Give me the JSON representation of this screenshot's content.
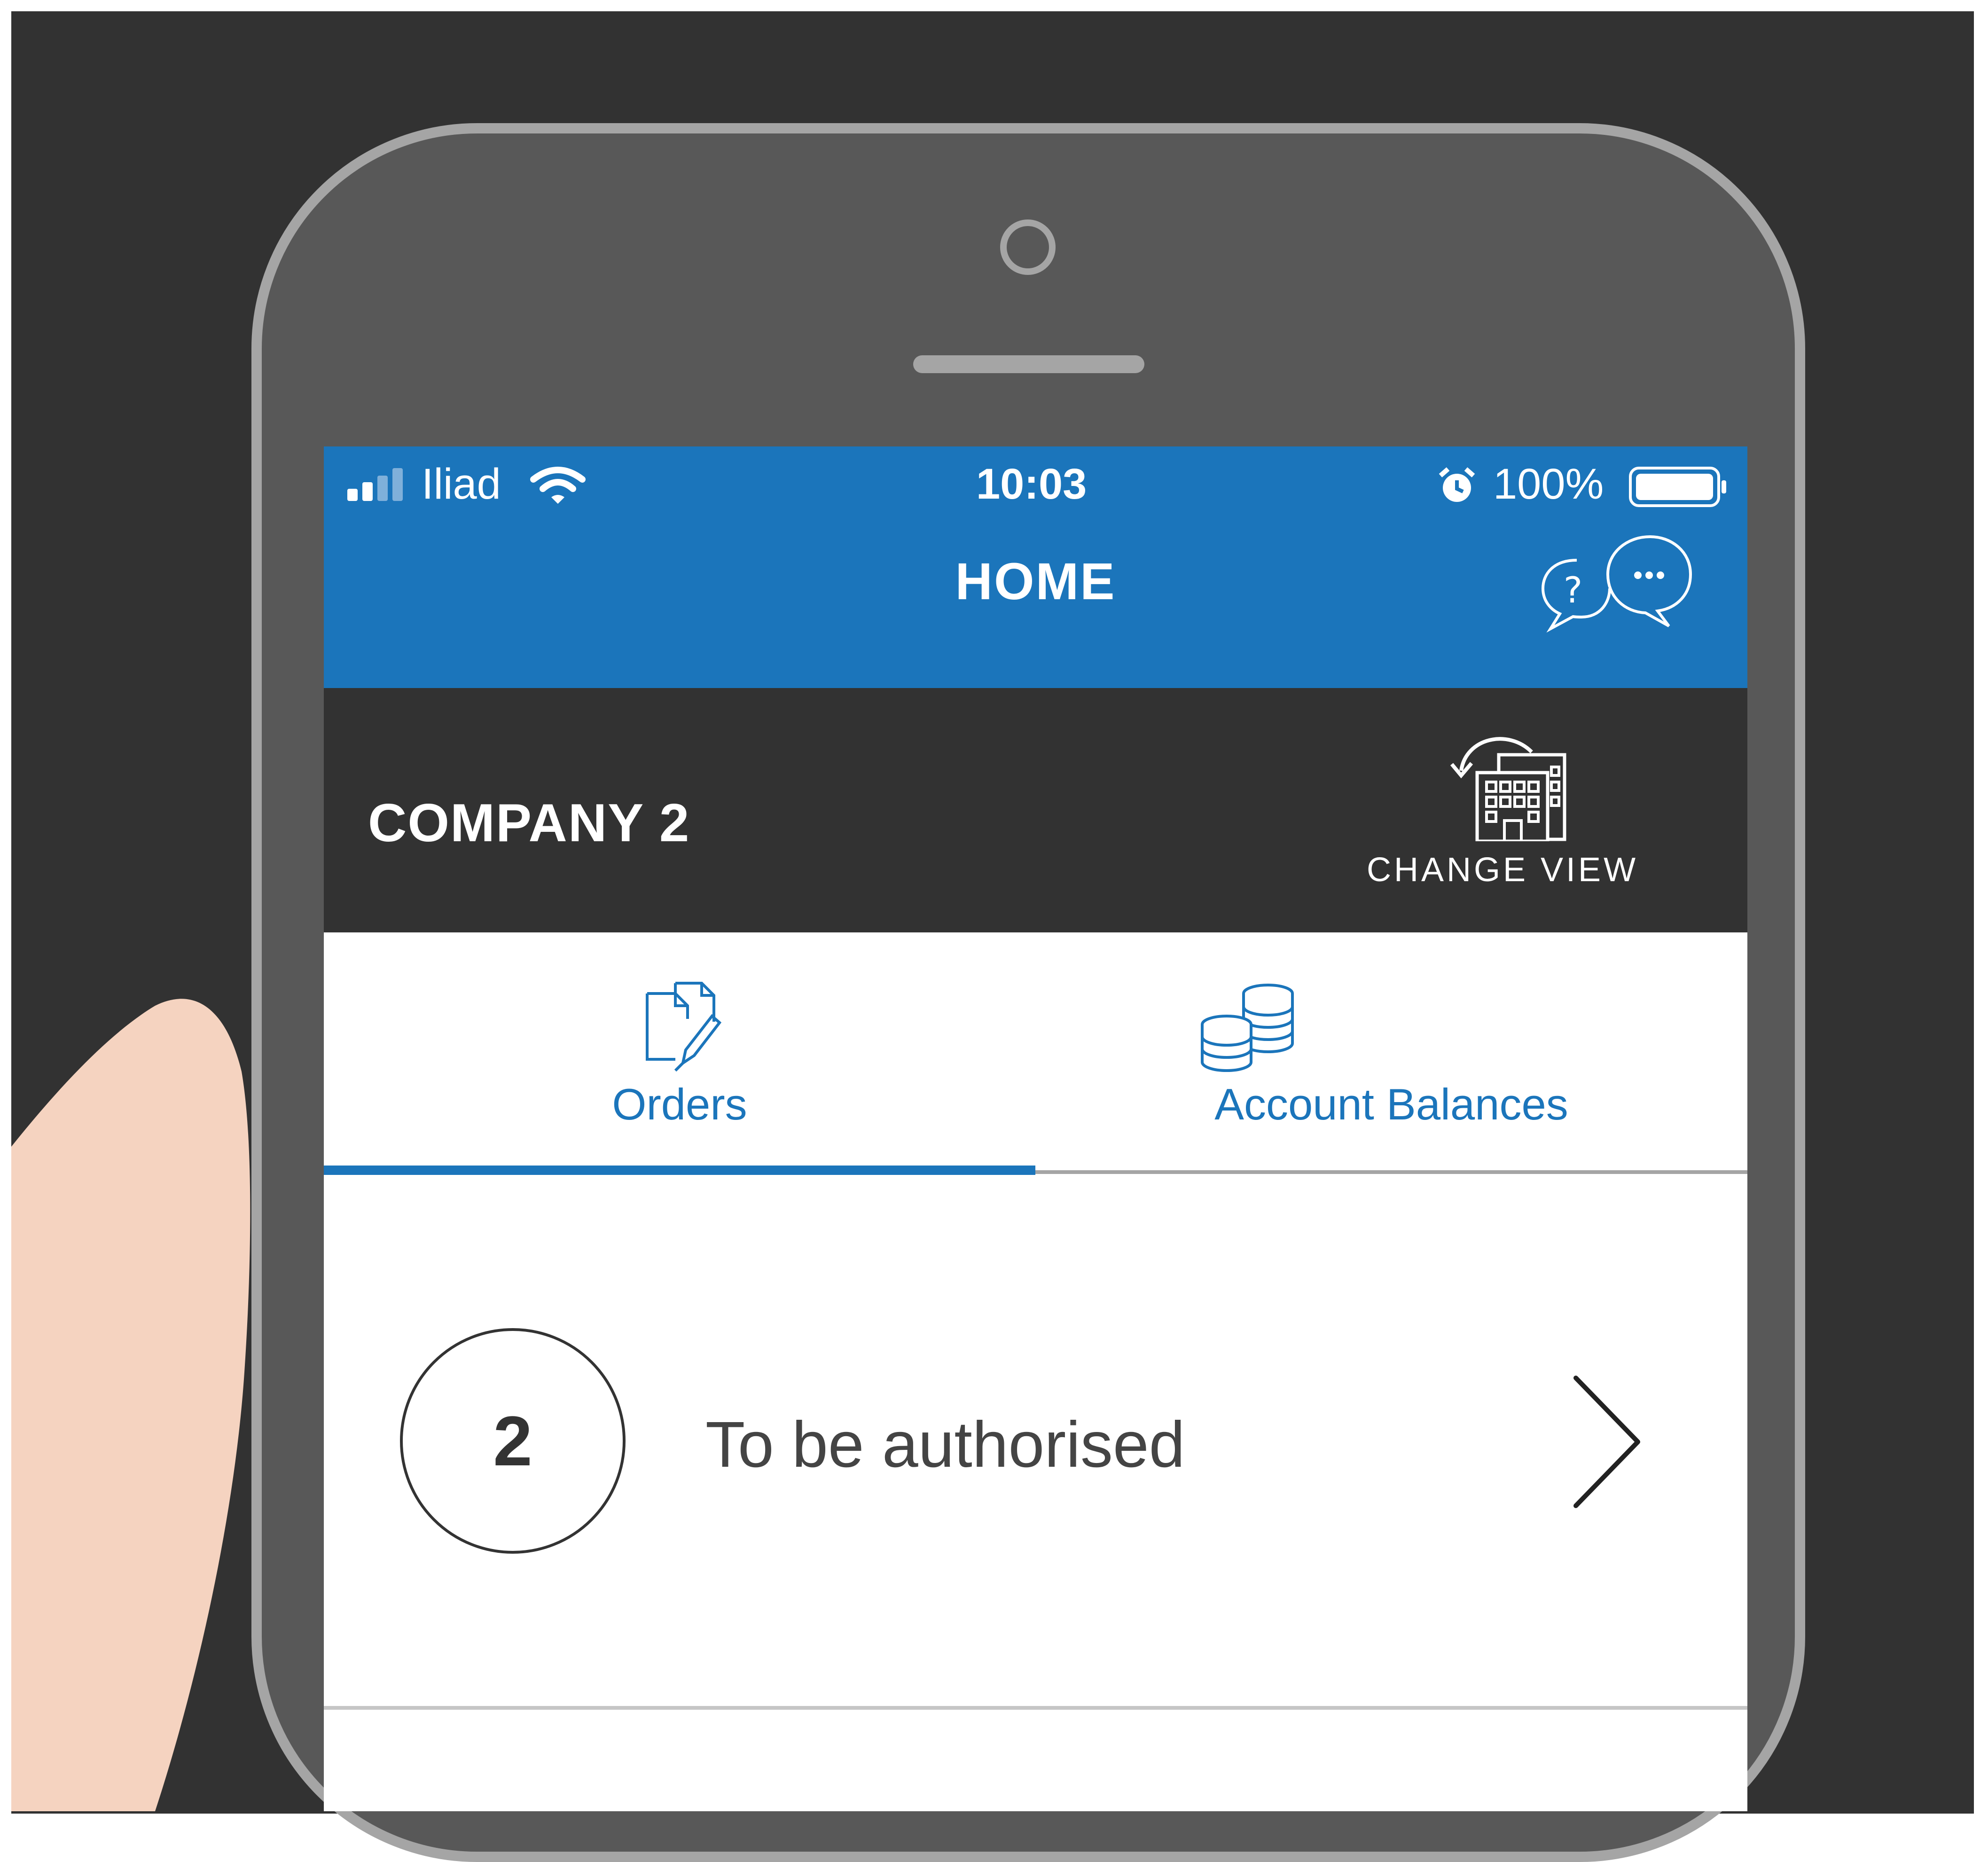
{
  "status_bar": {
    "carrier": "Iliad",
    "time": "10:03",
    "battery": "100%",
    "battery_level": 1.0,
    "signal_bars_active": 2,
    "icons": [
      "signal-icon",
      "wifi-icon",
      "alarm-icon",
      "battery-icon"
    ]
  },
  "header": {
    "title": "HOME",
    "help_icon": "help-chat-icon",
    "chat_icon": "chat-icon"
  },
  "company_bar": {
    "company_name": "COMPANY 2",
    "change_view_label": "CHANGE VIEW",
    "change_view_icon": "building-switch-icon"
  },
  "tabs": [
    {
      "label": "Orders",
      "icon": "orders-document-icon",
      "active": true
    },
    {
      "label": "Account Balances",
      "icon": "coins-stack-icon",
      "active": false
    }
  ],
  "orders": {
    "items": [
      {
        "count": "2",
        "label": "To be authorised"
      }
    ]
  },
  "colors": {
    "primary": "#1b75bb",
    "dark_bar": "#323232",
    "phone_body": "#585858",
    "phone_frame": "#a5a5a5",
    "finger": "#f5d3c0"
  }
}
